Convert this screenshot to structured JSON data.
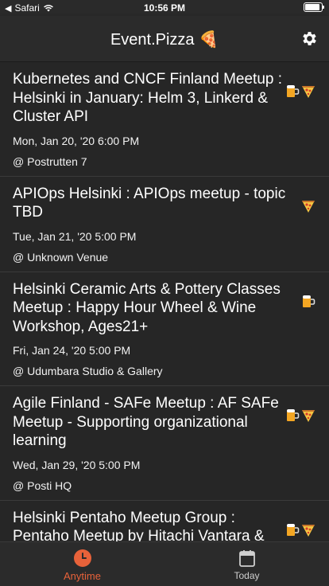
{
  "status_bar": {
    "carrier": "Safari",
    "time": "10:56 PM"
  },
  "nav": {
    "title": "Event.Pizza 🍕"
  },
  "events": [
    {
      "title": "Kubernetes and CNCF Finland Meetup : Helsinki in January: Helm 3, Linkerd & Cluster API",
      "date": "Mon, Jan 20, '20 6:00 PM",
      "venue": "@ Postrutten 7",
      "icons": [
        "beer-icon",
        "pizza-icon"
      ]
    },
    {
      "title": "APIOps Helsinki : APIOps meetup - topic TBD",
      "date": "Tue, Jan 21, '20 5:00 PM",
      "venue": "@ Unknown Venue",
      "icons": [
        "pizza-icon"
      ]
    },
    {
      "title": "Helsinki Ceramic Arts & Pottery Classes Meetup : Happy Hour Wheel & Wine Workshop, Ages21+",
      "date": "Fri, Jan 24, '20 5:00 PM",
      "venue": "@ Udumbara Studio & Gallery",
      "icons": [
        "beer-icon"
      ]
    },
    {
      "title": "Agile Finland - SAFe Meetup : AF SAFe Meetup - Supporting organizational learning",
      "date": "Wed, Jan 29, '20 5:00 PM",
      "venue": "@ Posti HQ",
      "icons": [
        "beer-icon",
        "pizza-icon"
      ]
    },
    {
      "title": "Helsinki Pentaho Meetup Group : Pentaho Meetup by Hitachi Vantara & HUS",
      "date": "",
      "venue": "",
      "icons": [
        "beer-icon",
        "pizza-icon"
      ]
    }
  ],
  "tabs": [
    {
      "label": "Anytime",
      "icon": "clock-icon",
      "active": true
    },
    {
      "label": "Today",
      "icon": "calendar-icon",
      "active": false
    }
  ],
  "colors": {
    "accent": "#e8623a",
    "background": "#252525",
    "bar": "#2b2b2b"
  }
}
